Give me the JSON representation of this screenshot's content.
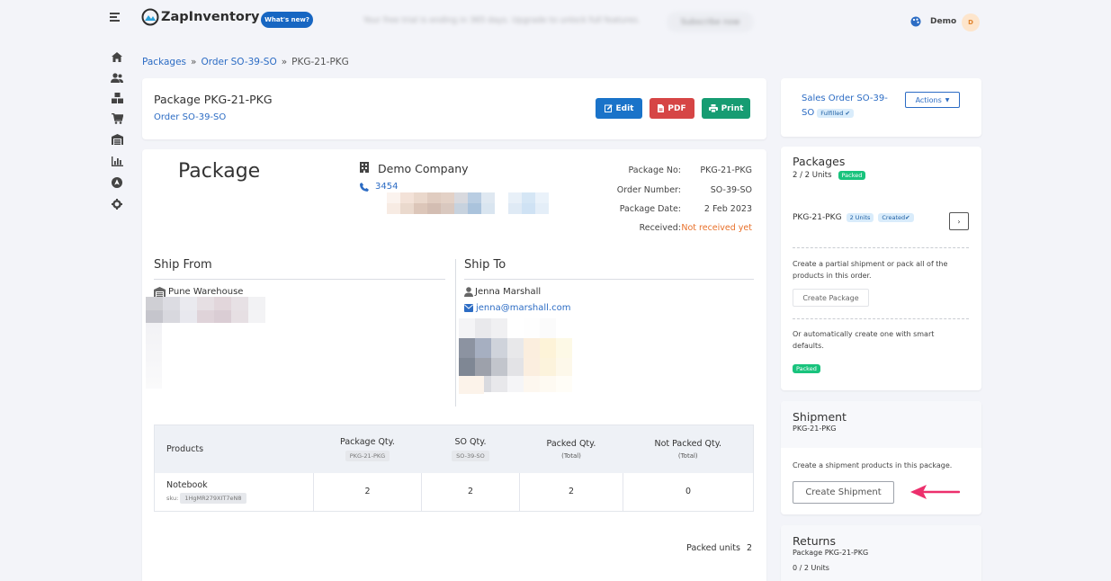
{
  "app": {
    "name": "ZapInventory",
    "whats_new": "What's new?",
    "banner_text": "Your free trial is ending in 365 days. Upgrade to unlock full features.",
    "subscribe": "Subscribe now",
    "user": "Demo",
    "user_initial": "D"
  },
  "sidebar": {
    "icons": [
      "home-icon",
      "users-icon",
      "boxes-icon",
      "cart-icon",
      "warehouse-icon",
      "chart-icon",
      "compass-icon",
      "gear-icon"
    ]
  },
  "breadcrumb": {
    "packages": "Packages",
    "order": "Order SO-39-SO",
    "current": "PKG-21-PKG"
  },
  "header": {
    "title": "Package PKG-21-PKG",
    "order_link": "Order SO-39-SO",
    "edit": "Edit",
    "pdf": "PDF",
    "print": "Print"
  },
  "package": {
    "heading": "Package",
    "company": "Demo Company",
    "phone": "3454",
    "details": [
      {
        "label": "Package No:",
        "value": "PKG-21-PKG"
      },
      {
        "label": "Order Number:",
        "value": "SO-39-SO"
      },
      {
        "label": "Package Date:",
        "value": "2 Feb 2023"
      },
      {
        "label": "Received:",
        "value": "Not received yet"
      }
    ],
    "ship_from": {
      "title": "Ship From",
      "warehouse": "Pune Warehouse"
    },
    "ship_to": {
      "title": "Ship To",
      "name": "Jenna Marshall",
      "email": "jenna@marshall.com"
    }
  },
  "table": {
    "headers": [
      {
        "label": "Products",
        "sub": ""
      },
      {
        "label": "Package Qty.",
        "sub": "PKG-21-PKG"
      },
      {
        "label": "SO Qty.",
        "sub": "SO-39-SO"
      },
      {
        "label": "Packed Qty.",
        "sub": "(Total)"
      },
      {
        "label": "Not Packed Qty.",
        "sub": "(Total)"
      }
    ],
    "rows": [
      {
        "product": "Notebook",
        "sku_label": "sku:",
        "sku": "1HgMR279XIT7eN8",
        "package_qty": "2",
        "so_qty": "2",
        "packed_qty": "2",
        "not_packed_qty": "0"
      }
    ],
    "packed_units_label": "Packed units",
    "packed_units": "2"
  },
  "right": {
    "sales_order": {
      "line1": "Sales Order SO-39-",
      "line2": "SO",
      "status": "Fulfilled",
      "actions": "Actions"
    },
    "packages": {
      "title": "Packages",
      "units": "2 / 2 Units",
      "status": "Packed",
      "pkg_name": "PKG-21-PKG",
      "pkg_units": "2 Units",
      "pkg_status": "Created",
      "partial_text": "Create a partial shipment or pack all of the products in this order.",
      "create_package": "Create Package",
      "auto_text": "Or automatically create one with smart defaults.",
      "auto_status": "Packed"
    },
    "shipment": {
      "title": "Shipment",
      "subtitle": "PKG-21-PKG",
      "text": "Create a shipment products in this package.",
      "button": "Create Shipment"
    },
    "returns": {
      "title": "Returns",
      "subtitle": "Package PKG-21-PKG",
      "units": "0 / 2 Units"
    }
  },
  "colors": {
    "primary": "#1a73c9",
    "danger": "#d64545",
    "success": "#169c72",
    "packed_badge": "#19c37d",
    "received_warning": "#e8702a",
    "arrow": "#ec2f6c"
  }
}
